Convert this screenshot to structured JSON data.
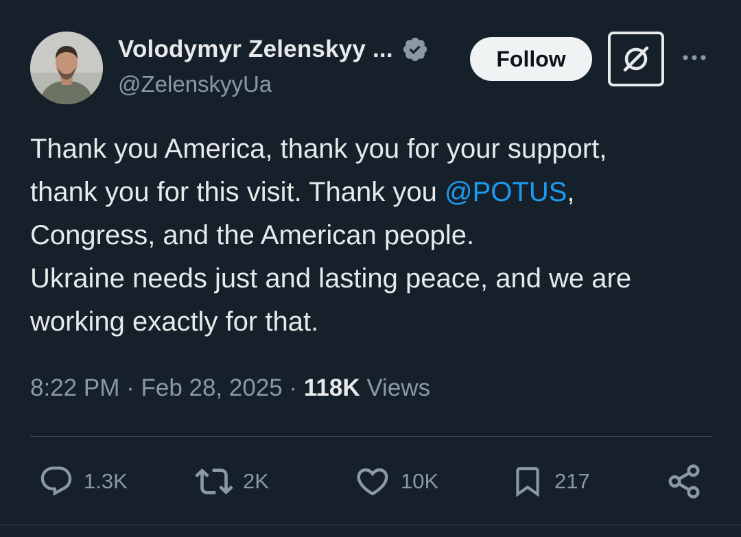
{
  "author": {
    "display_name": "Volodymyr Zelenskyy ...",
    "handle": "@ZelenskyyUa",
    "verified": true
  },
  "header": {
    "follow_label": "Follow",
    "more_label": "···"
  },
  "tweet": {
    "line1": "Thank you America, thank you for your support,",
    "line2_before": "thank you for this visit. Thank you ",
    "mention": "@POTUS",
    "line2_after": ",",
    "line3": "Congress, and the American people.",
    "line4": "Ukraine needs just and lasting peace, and we are",
    "line5": "working exactly for that."
  },
  "meta": {
    "time": "8:22 PM",
    "sep1": " · ",
    "date": "Feb 28, 2025",
    "sep2": " · ",
    "views_count": "118K",
    "views_label": " Views"
  },
  "actions": {
    "replies": "1.3K",
    "reposts": "2K",
    "likes": "10K",
    "bookmarks": "217"
  },
  "colors": {
    "background": "#15202b",
    "text": "#e7e9ea",
    "secondary": "#8b98a5",
    "link": "#1d9bf0",
    "divider": "#38444d"
  }
}
